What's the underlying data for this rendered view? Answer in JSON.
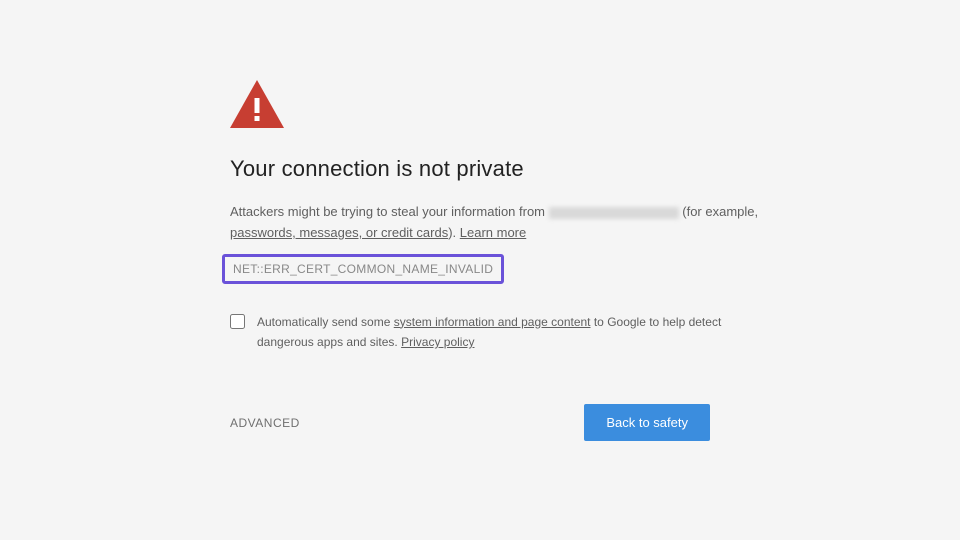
{
  "icon": {
    "name": "warning-triangle-icon",
    "fill": "#c73e32"
  },
  "title": "Your connection is not private",
  "body": {
    "prefix": "Attackers might be trying to steal your information from ",
    "suffix_open": " (for example, ",
    "clickable_examples": "passwords, messages, or credit cards",
    "suffix_close": "). ",
    "learn_more": "Learn more"
  },
  "error_code": "NET::ERR_CERT_COMMON_NAME_INVALID",
  "opt_in": {
    "checked": false,
    "text_pre": "Automatically send some ",
    "link1": "system information and page content",
    "text_mid": " to Google to help detect dangerous apps and sites. ",
    "link2": "Privacy policy"
  },
  "actions": {
    "advanced": "ADVANCED",
    "back": "Back to safety"
  },
  "highlight_color": "#6a52d9"
}
